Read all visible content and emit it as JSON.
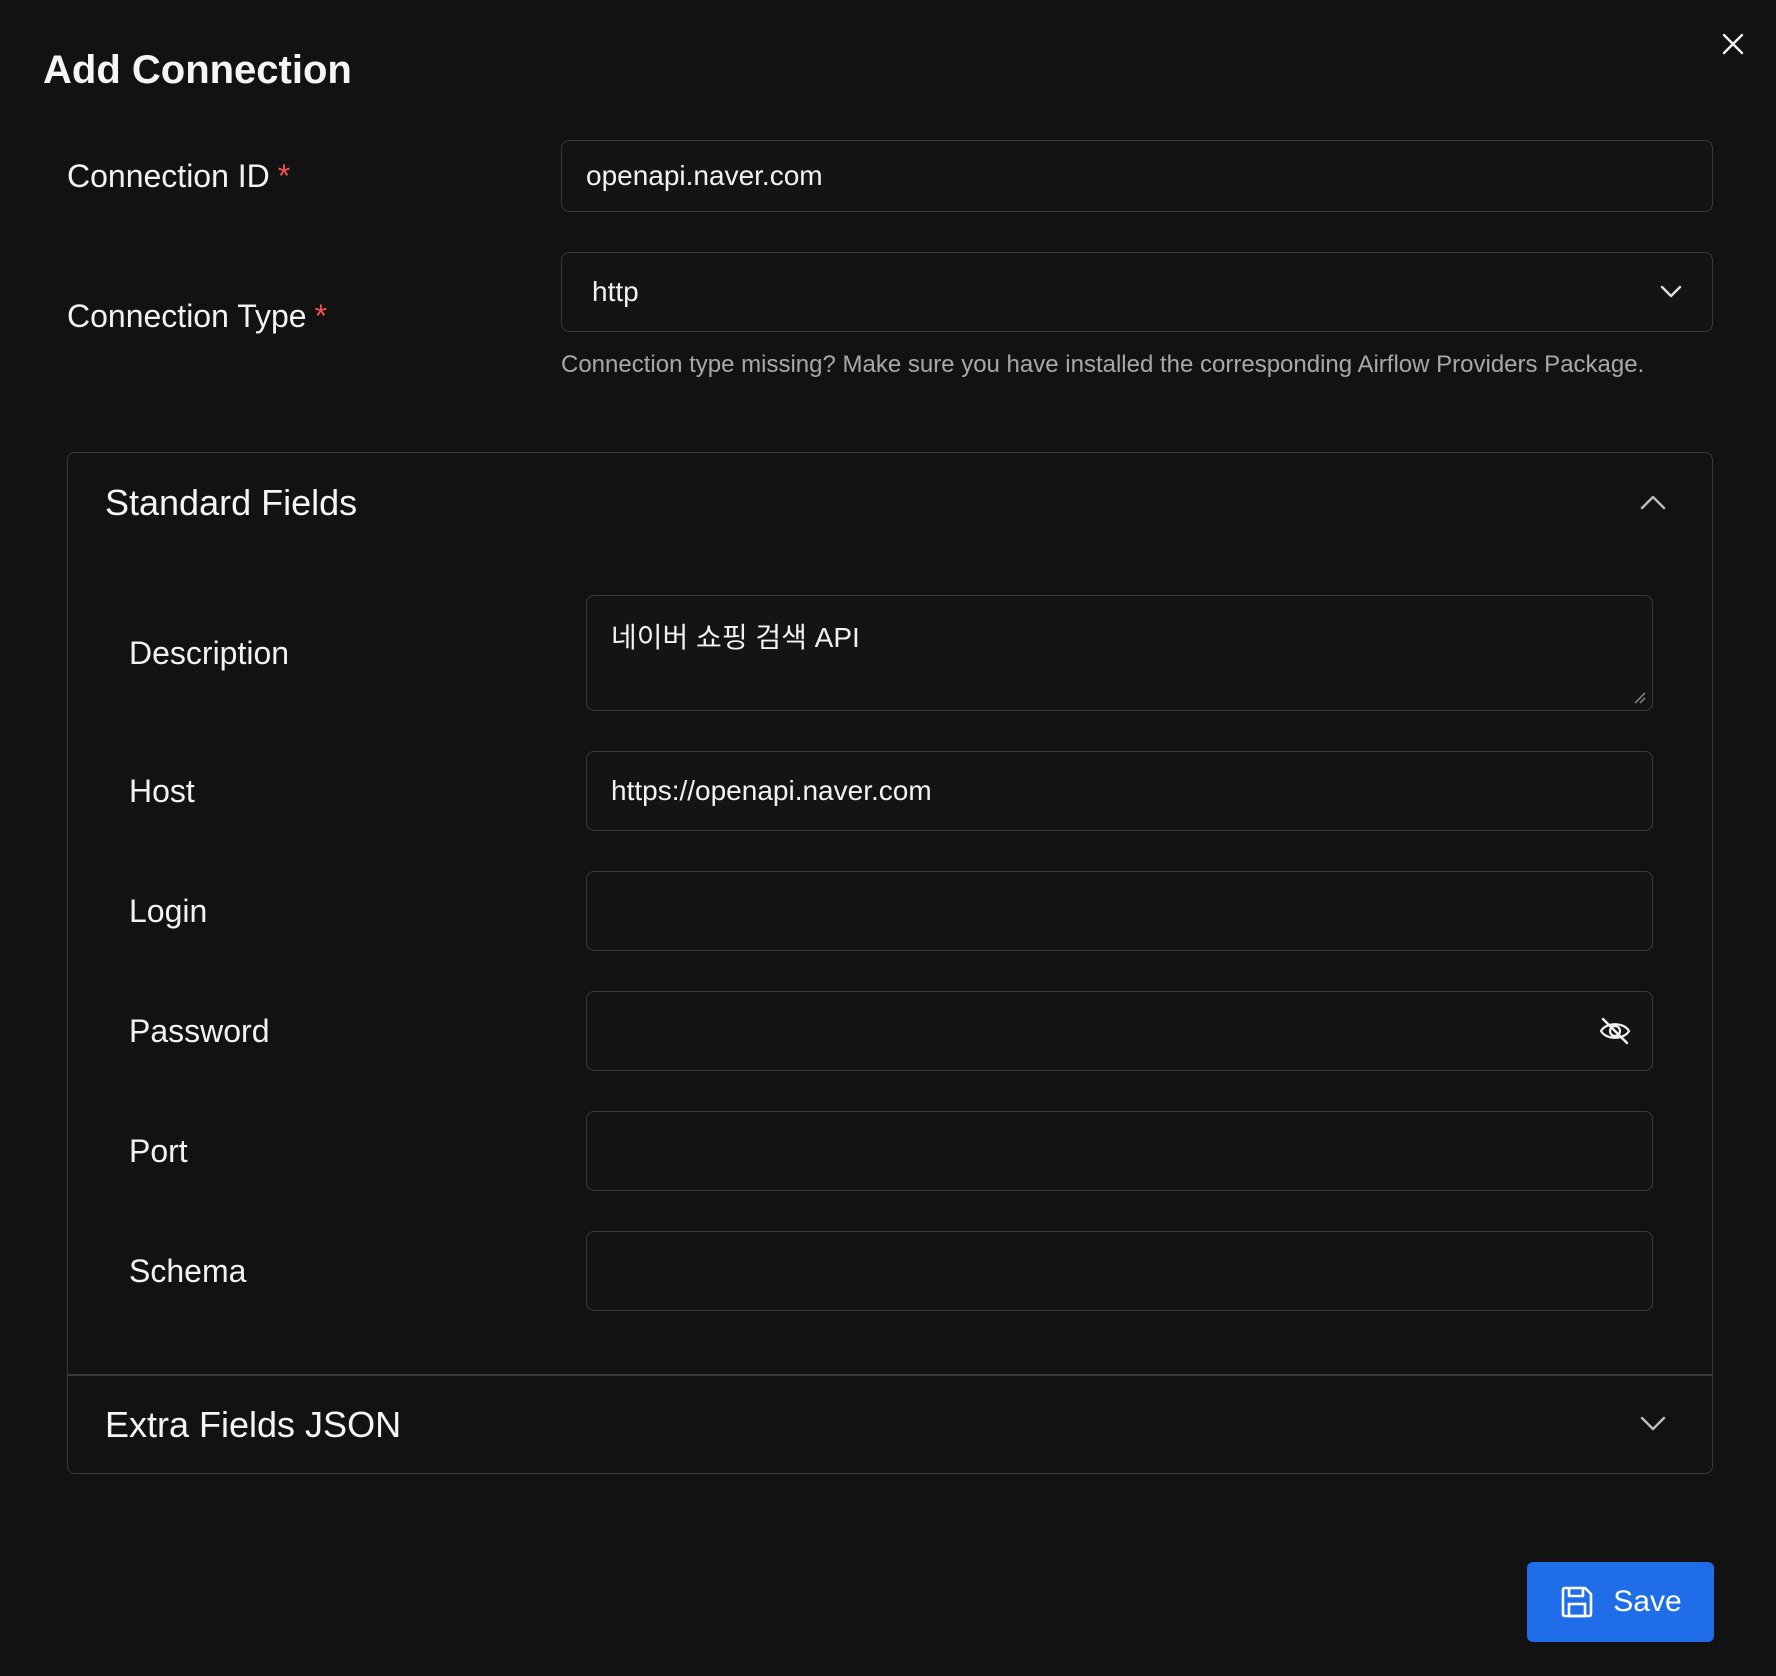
{
  "dialog": {
    "title": "Add Connection",
    "close_icon": "close-icon"
  },
  "connection_id": {
    "label": "Connection ID",
    "required_mark": "*",
    "value": "openapi.naver.com"
  },
  "connection_type": {
    "label": "Connection Type",
    "required_mark": "*",
    "value": "http",
    "hint": "Connection type missing? Make sure you have installed the corresponding Airflow Providers Package."
  },
  "standard_fields": {
    "title": "Standard Fields",
    "expanded": true,
    "fields": {
      "description": {
        "label": "Description",
        "value": "네이버 쇼핑 검색 API"
      },
      "host": {
        "label": "Host",
        "value": "https://openapi.naver.com"
      },
      "login": {
        "label": "Login",
        "value": ""
      },
      "password": {
        "label": "Password",
        "value": "",
        "toggle_icon": "eye-off-icon"
      },
      "port": {
        "label": "Port",
        "value": ""
      },
      "schema": {
        "label": "Schema",
        "value": ""
      }
    }
  },
  "extra_fields": {
    "title": "Extra Fields JSON",
    "expanded": false
  },
  "footer": {
    "save_label": "Save",
    "save_icon": "floppy-disk-icon"
  },
  "colors": {
    "background": "#121212",
    "border": "#3a3a3a",
    "required": "#ef5350",
    "primary": "#1f6de8",
    "hint_text": "#a8a8a8"
  }
}
